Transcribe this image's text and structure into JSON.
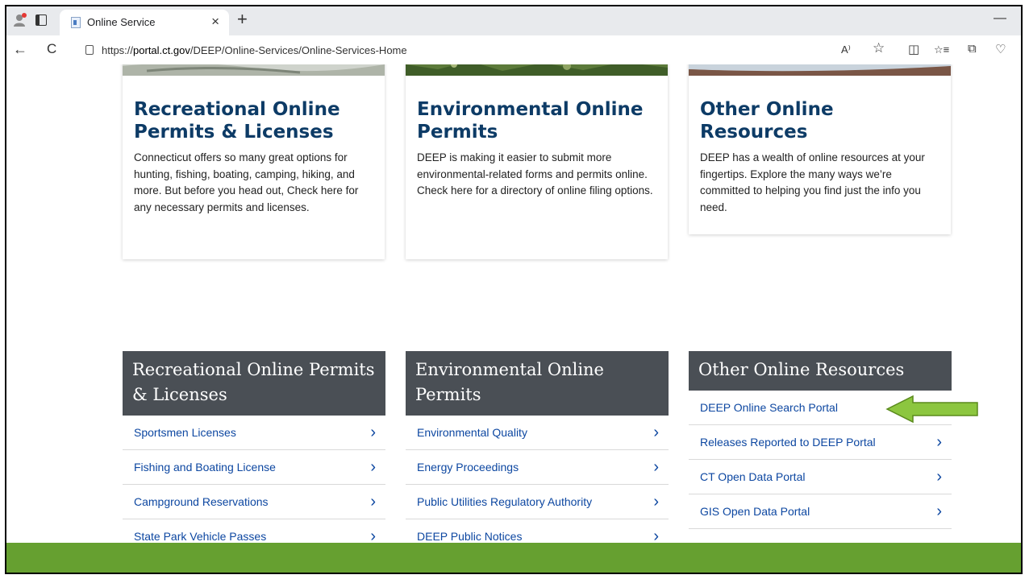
{
  "browser": {
    "tab_title": "Online Service",
    "tab_close": "×",
    "new_tab": "+",
    "minimize": "—",
    "back": "←",
    "refresh": "C",
    "url_prefix": "https://",
    "url_host": "portal.ct.gov",
    "url_path": "/DEEP/Online-Services/Online-Services-Home",
    "icons": [
      "read-aloud-icon",
      "favorite-star-icon",
      "split-screen-icon",
      "favorites-list-icon",
      "collections-icon",
      "browser-essentials-icon"
    ],
    "read_aloud_glyph": "A⁾",
    "star_glyph": "☆",
    "split_glyph": "◫",
    "favorites_glyph": "☆≡",
    "collections_glyph": "⧉",
    "essentials_glyph": "♡"
  },
  "cards": [
    {
      "title": "Recreational Online Permits & Licenses",
      "body": "Connecticut offers so many great options for hunting, fishing, boating, camping, hiking, and more. But before you head out, Check here for any necessary permits and licenses."
    },
    {
      "title": "Environmental Online Permits",
      "body": "DEEP is making it easier to submit more environmental-related forms and permits online. Check here for a directory of online filing options."
    },
    {
      "title": "Other Online Resources",
      "body": "DEEP has a wealth of online resources at your fingertips. Explore the many ways we’re committed to helping you find just the info you need."
    }
  ],
  "lists": [
    {
      "header": "Recreational Online Permits & Licenses",
      "items": [
        "Sportsmen Licenses",
        "Fishing and Boating License",
        "Campground Reservations",
        "State Park Vehicle Passes"
      ]
    },
    {
      "header": "Environmental Online Permits",
      "items": [
        "Environmental Quality",
        "Energy Proceedings",
        "Public Utilities Regulatory Authority",
        "DEEP Public Notices"
      ]
    },
    {
      "header": "Other Online Resources",
      "items": [
        "DEEP Online Search Portal",
        "Releases Reported to DEEP Portal",
        "CT Open Data Portal",
        "GIS Open Data Portal"
      ]
    }
  ],
  "chevron": "›",
  "colors": {
    "heading_blue": "#0d3b66",
    "link_blue": "#0d47a1",
    "header_gray": "#4a4f55",
    "footer_green": "#66a030",
    "arrow_green": "#8cc63f"
  }
}
